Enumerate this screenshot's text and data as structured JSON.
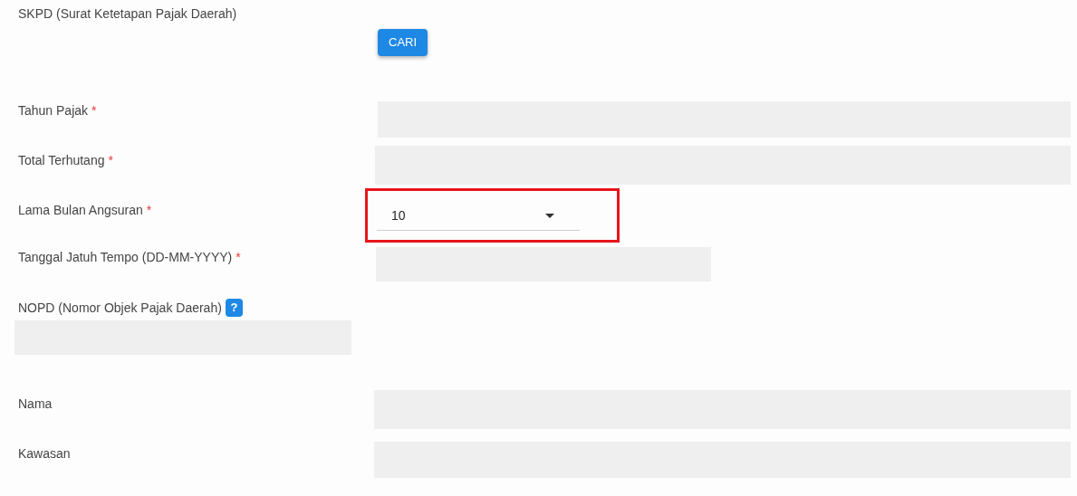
{
  "rows": [
    {
      "kind": "search",
      "label": "SKPD (Surat Ketetapan Pajak Daerah)",
      "button": "CARI"
    },
    {
      "kind": "text",
      "label": "Tahun Pajak",
      "mark": "*"
    },
    {
      "kind": "text",
      "label": "Total Terhutang",
      "mark": "*"
    },
    {
      "kind": "select",
      "label": "Lama Bulan Angsuran",
      "mark": "*",
      "value": "10",
      "highlighted": true
    },
    {
      "kind": "date",
      "label": "Tanggal Jatuh Tempo (DD-MM-YYYY)",
      "mark": "*"
    },
    {
      "kind": "nopd",
      "label": "NOPD (Nomor Objek Pajak Daerah)",
      "help": "?"
    },
    {
      "kind": "text",
      "label": "Nama"
    },
    {
      "kind": "text",
      "label": "Kawasan"
    }
  ]
}
